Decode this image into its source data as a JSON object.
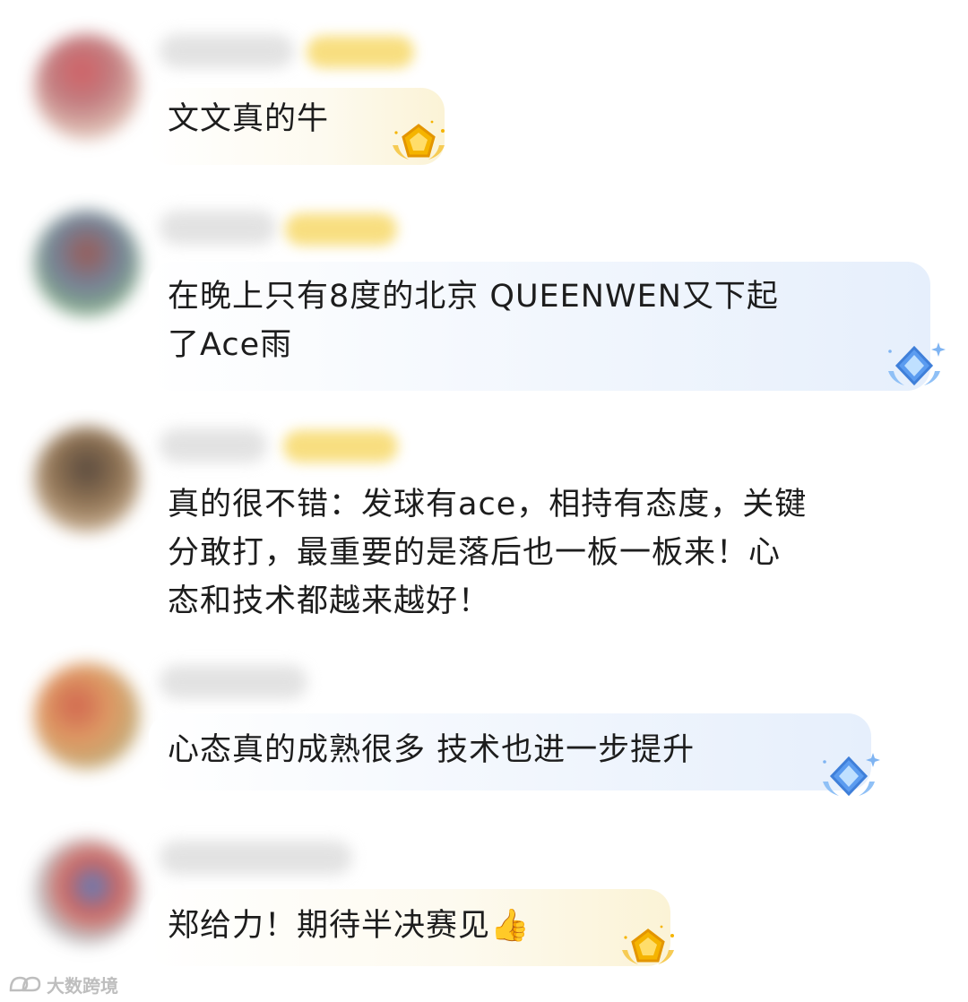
{
  "comments": [
    {
      "text": "文文真的牛",
      "badge": "gold-medal-icon"
    },
    {
      "text": "在晚上只有8度的北京 QUEENWEN又下起\n了Ace雨",
      "badge": "blue-diamond-icon"
    },
    {
      "text": "真的很不错：发球有ace，相持有态度，关键\n分敢打，最重要的是落后也一板一板来！心\n态和技术都越来越好！",
      "badge": ""
    },
    {
      "text": "心态真的成熟很多 技术也进一步提升",
      "badge": "blue-diamond-icon"
    },
    {
      "text": "郑给力！期待半决赛见👍",
      "badge": "gold-medal-icon"
    }
  ],
  "watermark": {
    "text": "大数跨境"
  },
  "colors": {
    "text": "#1d1d1d",
    "gold": "#f5b400",
    "blue": "#5b9cf0",
    "username_blur": "#d9d9d9",
    "level_badge": "#f7d96a"
  }
}
